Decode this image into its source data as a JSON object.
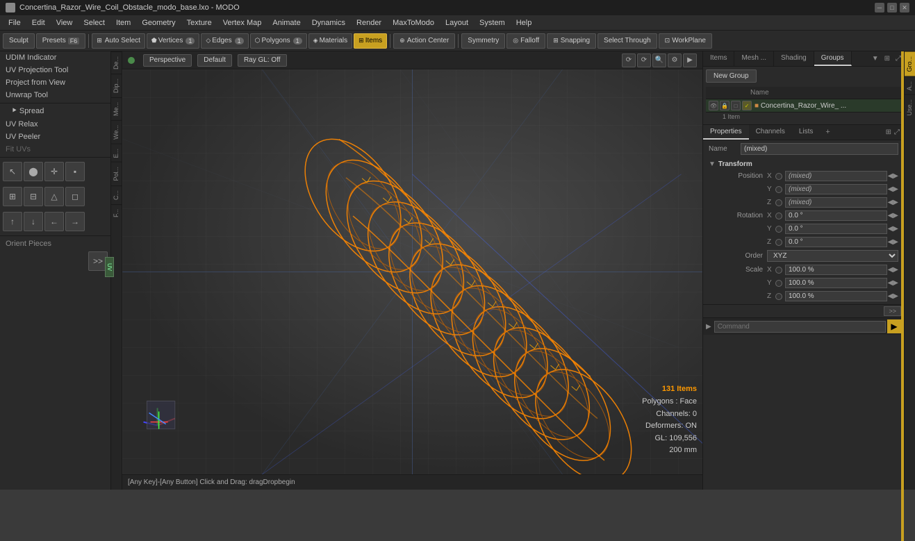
{
  "titlebar": {
    "title": "Concertina_Razor_Wire_Coil_Obstacle_modo_base.lxo - MODO",
    "app_icon": "modo-icon",
    "minimize": "─",
    "maximize": "□",
    "close": "✕"
  },
  "menubar": {
    "items": [
      "File",
      "Edit",
      "View",
      "Select",
      "Item",
      "Geometry",
      "Texture",
      "Vertex Map",
      "Animate",
      "Dynamics",
      "Render",
      "MaxToModo",
      "Layout",
      "System",
      "Help"
    ]
  },
  "toolbar": {
    "sculpt": "Sculpt",
    "presets": "Presets",
    "presets_shortcut": "F6",
    "auto_select": "Auto Select",
    "vertices": "Vertices",
    "vertices_count": "1",
    "edges": "Edges",
    "edges_count": "1",
    "polygons": "Polygons",
    "polygons_count": "1",
    "materials": "Materials",
    "items": "Items",
    "action_center": "Action Center",
    "symmetry": "Symmetry",
    "falloff": "Falloff",
    "snapping": "Snapping",
    "select_through": "Select Through",
    "workplane": "WorkPlane"
  },
  "left_panel": {
    "items": [
      {
        "label": "UDIM Indicator",
        "id": "udim-indicator"
      },
      {
        "label": "UV Projection Tool",
        "id": "uv-projection-tool"
      },
      {
        "label": "Project from View",
        "id": "project-from-view"
      },
      {
        "label": "Unwrap Tool",
        "id": "unwrap-tool"
      },
      {
        "label": "Spread",
        "id": "spread",
        "indent": true
      },
      {
        "label": "UV Relax",
        "id": "uv-relax"
      },
      {
        "label": "UV Peeler",
        "id": "uv-peeler"
      },
      {
        "label": "Fit UVs",
        "id": "fit-uvs",
        "muted": true
      }
    ],
    "icons_row1": [
      "arrow-up-left",
      "sphere",
      "move-xy",
      "cube"
    ],
    "icons_row2": [
      "grid",
      "uv-grid",
      "mountain",
      "cube-small"
    ],
    "icons_row3": [
      "arrow-up",
      "arrow-down",
      "arrow-left",
      "arrow-right"
    ],
    "orient_pieces": "Orient Pieces",
    "more_btn": ">>"
  },
  "side_tabs": [
    "De...",
    "Dip...",
    "Me...",
    "We...",
    "E...",
    "Pol...",
    "C..."
  ],
  "viewport": {
    "indicator_color": "#4a8a4a",
    "perspective": "Perspective",
    "default_label": "Default",
    "ray_gl": "Ray GL: Off",
    "controls": [
      "orbit",
      "zoom",
      "pan",
      "settings",
      "more"
    ]
  },
  "stats": {
    "items": "131 Items",
    "polygons": "Polygons : Face",
    "channels": "Channels: 0",
    "deformers": "Deformers: ON",
    "gl": "GL: 109,556",
    "size": "200 mm"
  },
  "status_bar": {
    "text": "[Any Key]-[Any Button] Click and Drag:   dragDropbegin"
  },
  "right_panel": {
    "tabs": [
      "Items",
      "Mesh ...",
      "Shading",
      "Groups"
    ],
    "active_tab": "Groups",
    "new_group_btn": "New Group",
    "table_cols": [
      "",
      "",
      "",
      "",
      "Name"
    ],
    "item": {
      "name": "Concertina_Razor_Wire_ ...",
      "sub": "1 Item",
      "icons": [
        "eye",
        "lock",
        "box",
        "visible"
      ]
    }
  },
  "properties": {
    "tabs": [
      "Properties",
      "Channels",
      "Lists"
    ],
    "active_tab": "Properties",
    "add_btn": "+",
    "name_label": "Name",
    "name_value": "(mixed)",
    "transform_label": "Transform",
    "transform_arrow": "▼",
    "position": {
      "label": "Position",
      "x_axis": "X",
      "y_axis": "Y",
      "z_axis": "Z",
      "x_value": "(mixed)",
      "y_value": "(mixed)",
      "z_value": "(mixed)"
    },
    "rotation": {
      "label": "Rotation",
      "x_axis": "X",
      "y_axis": "Y",
      "z_axis": "Z",
      "x_value": "0.0 °",
      "y_value": "0.0 °",
      "z_value": "0.0 °"
    },
    "order_label": "Order",
    "order_value": "XYZ",
    "scale": {
      "label": "Scale",
      "x_axis": "X",
      "y_axis": "Y",
      "z_axis": "Z",
      "x_value": "100.0 %",
      "y_value": "100.0 %",
      "z_value": "100.0 %"
    }
  },
  "right_side_tabs": [
    "Gro...",
    "A...",
    "Use..."
  ],
  "command_bar": {
    "placeholder": "Command",
    "exec_btn": "▶"
  },
  "colors": {
    "accent": "#c8a020",
    "bg_dark": "#1e1e1e",
    "bg_mid": "#2a2a2a",
    "bg_light": "#3a3a3a",
    "border": "#555555",
    "text_dim": "#888888",
    "text_bright": "#cccccc",
    "active_item": "#2a3a2a",
    "orange": "#ff9900"
  }
}
